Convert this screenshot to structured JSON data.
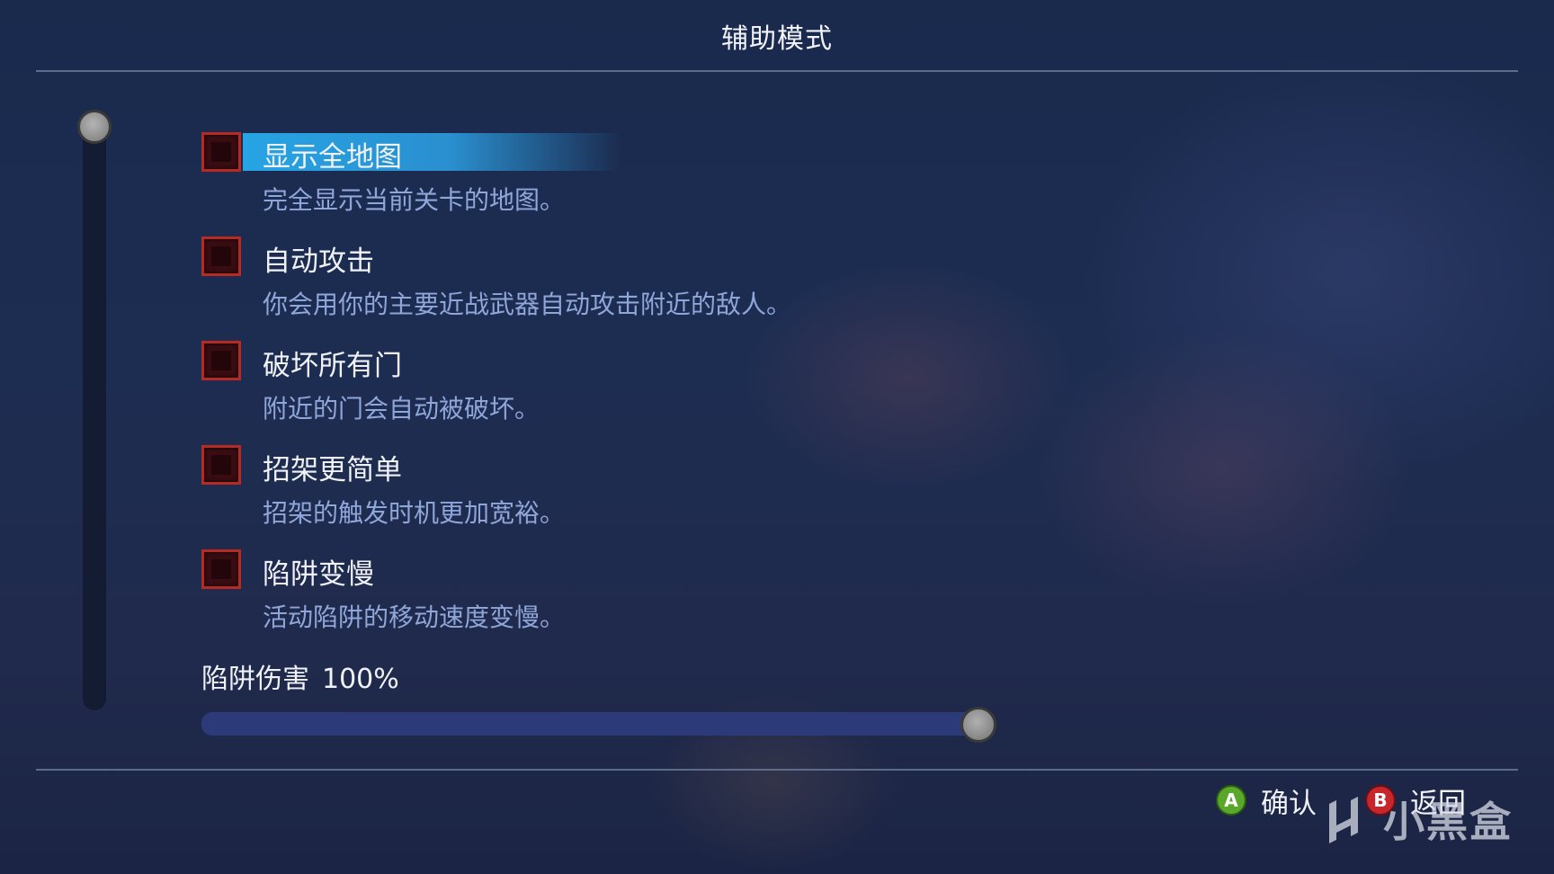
{
  "header": {
    "title": "辅助模式"
  },
  "options": [
    {
      "label": "显示全地图",
      "description": "完全显示当前关卡的地图。",
      "checked": false,
      "selected": true
    },
    {
      "label": "自动攻击",
      "description": "你会用你的主要近战武器自动攻击附近的敌人。",
      "checked": false,
      "selected": false
    },
    {
      "label": "破坏所有门",
      "description": "附近的门会自动被破坏。",
      "checked": false,
      "selected": false
    },
    {
      "label": "招架更简单",
      "description": "招架的触发时机更加宽裕。",
      "checked": false,
      "selected": false
    },
    {
      "label": "陷阱变慢",
      "description": "活动陷阱的移动速度变慢。",
      "checked": false,
      "selected": false
    }
  ],
  "slider": {
    "label": "陷阱伤害",
    "value_text": "100%",
    "value": 1.0
  },
  "footer": {
    "confirm": {
      "glyph": "A",
      "label": "确认",
      "color": "#59a82a"
    },
    "back": {
      "glyph": "B",
      "label": "返回",
      "color": "#c7262c"
    }
  },
  "watermark": {
    "text": "小黑盒"
  },
  "colors": {
    "highlight": "#27a4e4",
    "checkbox_border": "#b52a22",
    "description_text": "#8fa6d8"
  }
}
